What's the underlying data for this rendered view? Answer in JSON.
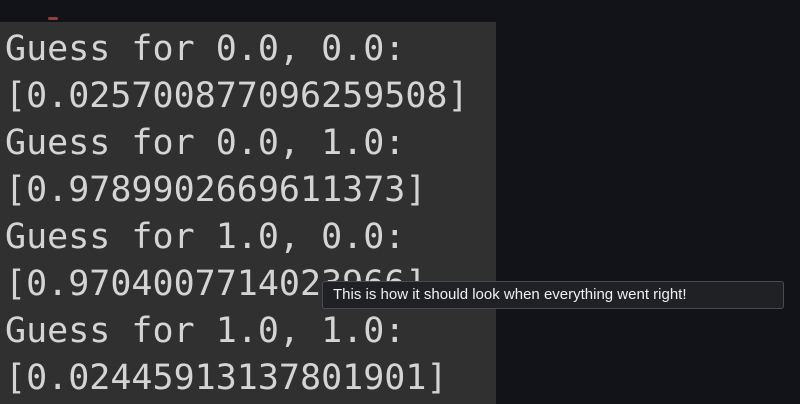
{
  "terminal": {
    "lines": [
      "Guess for 0.0, 0.0:",
      "[0.025700877096259508]",
      "Guess for 0.0, 1.0:",
      "[0.9789902669611373]",
      "Guess for 1.0, 0.0:",
      "[0.9704007714023966]",
      "Guess for 1.0, 1.0:",
      "[0.02445913137801901]"
    ]
  },
  "tooltip": {
    "text": "This is how it should look when everything went right!"
  },
  "colors": {
    "background": "#111318",
    "terminal_background": "#303030",
    "terminal_text": "#d4d4d4",
    "tooltip_background": "#202124",
    "tooltip_text": "#f0f0f0"
  }
}
